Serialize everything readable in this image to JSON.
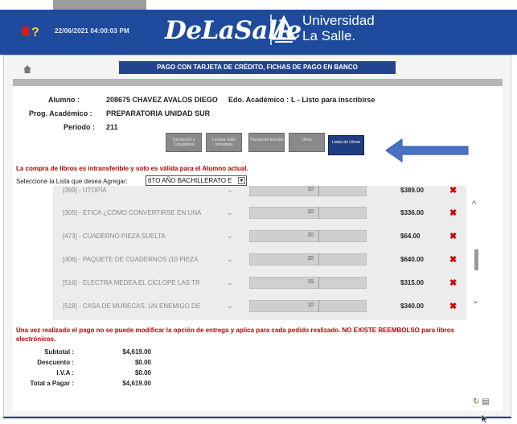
{
  "header": {
    "datetime": "22/06/2021 04:00:03 PM",
    "logo_script": "DeLaSalle",
    "logo_line1": "Universidad",
    "logo_line2": "La Salle."
  },
  "page_title": "PAGO CON TARJETA DE CRÉDITO, FICHAS DE PAGO EN BANCO",
  "student": {
    "alumno_label": "Alumno :",
    "alumno_value": "208675 CHAVEZ AVALOS DIEGO",
    "estado_label": "Edo. Académico :",
    "estado_value": "L - Listo para inscribirse",
    "programa_label": "Prog. Académico :",
    "programa_value": "PREPARATORIA UNIDAD SUR",
    "periodo_label": "Periodo :",
    "periodo_value": "211"
  },
  "tabs": [
    {
      "label": "Inscripción y Colegiatura"
    },
    {
      "label": "Lectura Salle Inmediata"
    },
    {
      "label": "Transporte Escolar"
    },
    {
      "label": "Otros"
    },
    {
      "label": "Listas de Libros"
    }
  ],
  "notice_top": "La compra de libros es intransferible y solo es válida para el Alumno actual.",
  "select": {
    "label": "Seleccione la Lista que desea Agregar:",
    "value": "6TO AÑO BACHILLERATO E"
  },
  "items": [
    {
      "name": "[399] - UTOPÍA",
      "qty": "10",
      "price": "$389.00"
    },
    {
      "name": "[305] - ÉTICA ¿CÓMO CONVERTIRSE EN UNA",
      "qty": "10",
      "price": "$336.00"
    },
    {
      "name": "[473] - CUADERNO PIEZA SUELTA",
      "qty": "20",
      "price": "$64.00"
    },
    {
      "name": "[406] - PAQUETE DE CUADERNOS (10 PIEZA",
      "qty": "20",
      "price": "$640.00"
    },
    {
      "name": "[516] - ELECTRA MEDEA EL CÍCLOPE LAS TR",
      "qty": "15",
      "price": "$315.00"
    },
    {
      "name": "[518] - CASA DE MUÑECAS. UN ENEMIGO DE",
      "qty": "10",
      "price": "$340.00"
    }
  ],
  "notice_bottom": "Una vez realizado el pago no se puede modificar la opción de entrega y aplica para cada pedido realizado. NO EXISTE REEMBOLSO para libros electrónicos.",
  "summary": {
    "subtotal_label": "Subtotal :",
    "subtotal_value": "$4,619.00",
    "descuento_label": "Descuento :",
    "descuento_value": "$0.00",
    "iva_label": "I.V.A :",
    "iva_value": "$0.00",
    "total_label": "Total a Pagar :",
    "total_value": "$4,619.00"
  },
  "colors": {
    "header_blue": "#1f4b9e",
    "title_blue": "#23458f",
    "alert_red": "#c00000",
    "arrow_blue": "#4a72c4"
  }
}
